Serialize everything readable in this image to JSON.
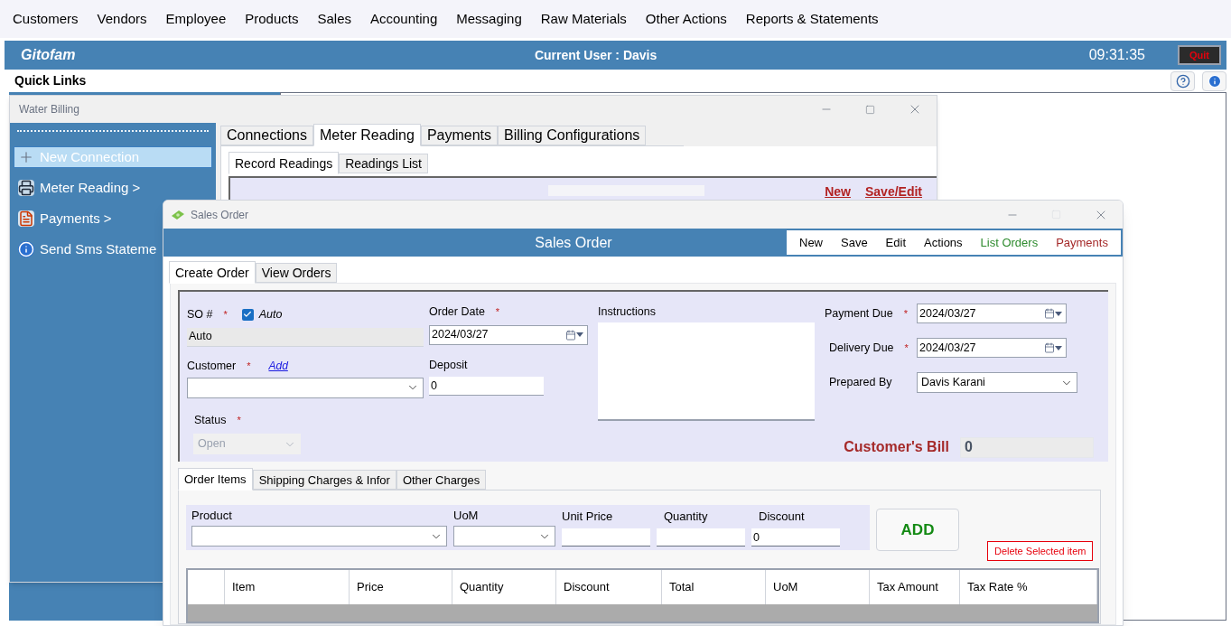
{
  "menu": [
    "Customers",
    "Vendors",
    "Employee",
    "Products",
    "Sales",
    "Accounting",
    "Messaging",
    "Raw Materials",
    "Other Actions",
    "Reports & Statements"
  ],
  "header": {
    "brand": "Gitofam",
    "user": "Current User : Davis",
    "time": "09:31:35",
    "quit": "Quit"
  },
  "quick_links": {
    "title": "Quick Links"
  },
  "water_billing": {
    "title": "Water Billing",
    "maximize_disabled": false,
    "sidebar": [
      {
        "label": "New Connection",
        "selected": true,
        "kind": "plus"
      },
      {
        "label": "Meter Reading >",
        "selected": false,
        "kind": "printer"
      },
      {
        "label": "Payments >",
        "selected": false,
        "kind": "note"
      },
      {
        "label": "Send Sms Stateme",
        "selected": false,
        "kind": "info"
      }
    ],
    "tabs": [
      {
        "label": "Connections",
        "selected": false
      },
      {
        "label": "Meter Reading",
        "selected": true
      },
      {
        "label": "Payments",
        "selected": false
      },
      {
        "label": "Billing Configurations",
        "selected": false
      }
    ],
    "subtabs": [
      {
        "label": "Record Readings",
        "selected": true
      },
      {
        "label": "Readings List",
        "selected": false
      }
    ],
    "links": [
      "New",
      "Save/Edit"
    ]
  },
  "sales_order": {
    "title": "Sales Order",
    "maximize_disabled": true,
    "banner": "Sales Order",
    "toolbar": [
      {
        "label": "New",
        "color": "#000000"
      },
      {
        "label": "Save",
        "color": "#000000"
      },
      {
        "label": "Edit",
        "color": "#000000"
      },
      {
        "label": "Actions",
        "color": "#000000"
      },
      {
        "label": "List Orders",
        "color": "#2e8b2e"
      },
      {
        "label": "Payments",
        "color": "#a52a2a"
      }
    ],
    "tabs": [
      {
        "label": "Create Order",
        "selected": true
      },
      {
        "label": "View Orders",
        "selected": false
      }
    ],
    "form": {
      "so": {
        "label": "SO #",
        "mark": "*",
        "auto_label": "Auto",
        "checked": true,
        "value": "Auto"
      },
      "customer": {
        "label": "Customer",
        "mark": "*",
        "link": "Add"
      },
      "status": {
        "label": "Status",
        "mark": "*",
        "value": "Open",
        "disabled": true
      },
      "order_date": {
        "label": "Order Date",
        "mark": "*",
        "value": "2024/03/27"
      },
      "deposit": {
        "label": "Deposit",
        "value": "0"
      },
      "instructions": {
        "label": "Instructions"
      },
      "payment_due": {
        "label": "Payment Due",
        "mark": "*",
        "value": "2024/03/27"
      },
      "delivery_due": {
        "label": "Delivery Due",
        "mark": "*",
        "value": "2024/03/27"
      },
      "prepared_by": {
        "label": "Prepared By",
        "value": "Davis Karani"
      },
      "bill": {
        "label": "Customer's Bill",
        "value": "0"
      }
    },
    "item_tabs": [
      {
        "label": "Order Items",
        "selected": true
      },
      {
        "label": "Shipping Charges & Infor",
        "selected": false
      },
      {
        "label": "Other Charges",
        "selected": false
      }
    ],
    "item_entry": {
      "product": {
        "label": "Product"
      },
      "uom": {
        "label": "UoM"
      },
      "unit_price": {
        "label": "Unit Price"
      },
      "quantity": {
        "label": "Quantity"
      },
      "discount": {
        "label": "Discount",
        "value": "0"
      }
    },
    "add_button": "ADD",
    "delete_button": "Delete Selected item",
    "table": {
      "columns": [
        "Item",
        "Price",
        "Quantity",
        "Discount",
        "Total",
        "UoM",
        "Tax Amount",
        "Tax Rate %"
      ]
    }
  }
}
